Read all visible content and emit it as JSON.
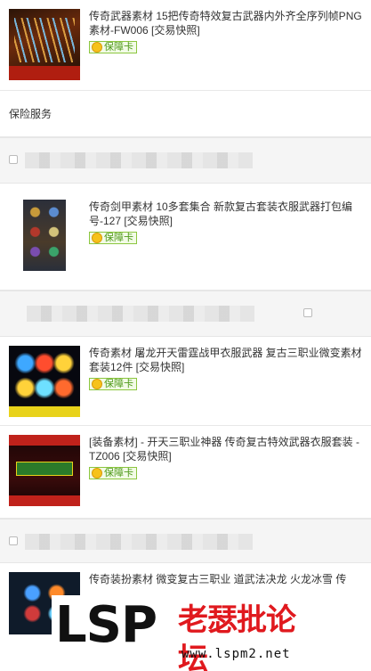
{
  "products": [
    {
      "title": "传奇武器素材 15把传奇特效复古武器内外齐全序列帧PNG素材-FW006 [交易快照]",
      "badge": "保障卡"
    },
    {
      "title": "传奇剑甲素材 10多套集合 新款复古套装衣服武器打包编号-127 [交易快照]",
      "badge": "保障卡"
    },
    {
      "title": "传奇素材 屠龙开天雷霆战甲衣服武器 复古三职业微变素材套装12件 [交易快照]",
      "badge": "保障卡"
    },
    {
      "title": "[装备素材] - 开天三职业神器 传奇复古特效武器衣服套装 - TZ006 [交易快照]",
      "badge": "保障卡"
    },
    {
      "title": "传奇装扮素材 微变复古三职业 道武法决龙 火龙冰雪 传"
    }
  ],
  "insurance_label": "保险服务",
  "watermark": {
    "logo": "LSP",
    "site_name": "老瑟批论坛",
    "url": "www.lspm2.net"
  }
}
